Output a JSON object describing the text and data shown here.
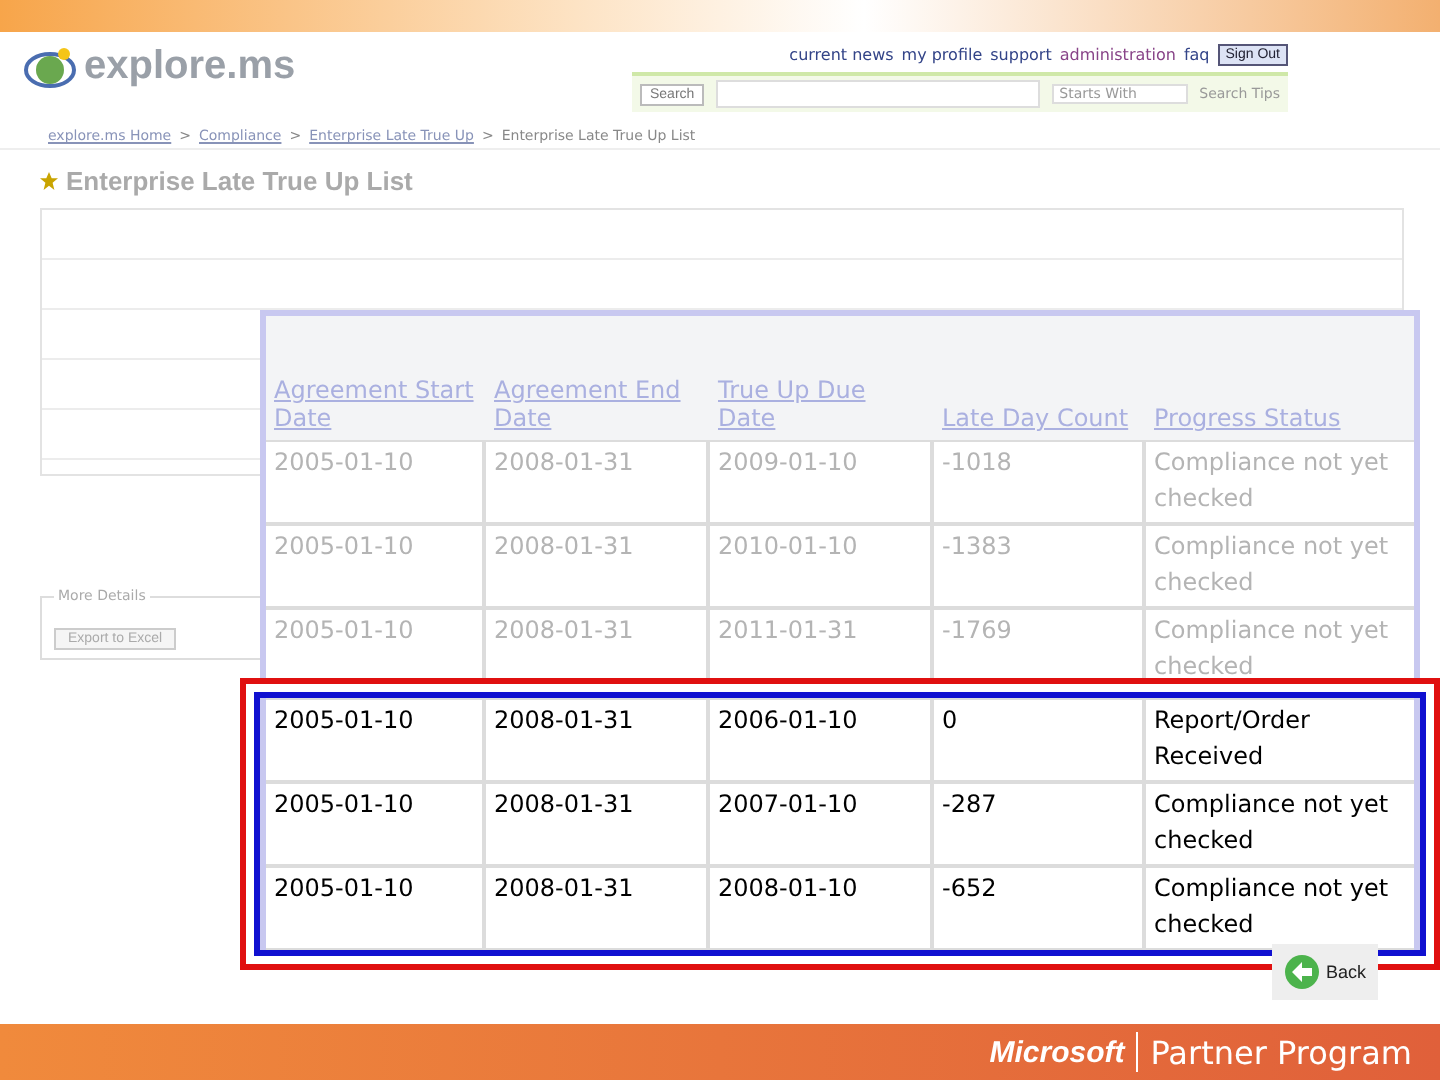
{
  "header": {
    "logo": "explore.ms",
    "nav": [
      "current news",
      "my profile",
      "support",
      "administration",
      "faq"
    ],
    "sign_out": "Sign Out",
    "search_button": "Search",
    "match_mode": "Starts With",
    "search_tips": "Search Tips"
  },
  "breadcrumb_separator": ">",
  "breadcrumbs": [
    "explore.ms Home",
    "Compliance",
    "Enterprise Late True Up",
    "Enterprise Late True Up List"
  ],
  "title": "Enterprise Late True Up List",
  "more_details": {
    "legend": "More Details",
    "button": "Export to Excel"
  },
  "zoom_table": {
    "columns": [
      "Agreement Start Date",
      "Agreement End Date",
      "True Up Due Date",
      "Late Day Count",
      "Progress Status"
    ],
    "rows": [
      {
        "cells": [
          "2005-01-10",
          "2008-01-31",
          "2009-01-10",
          "-1018",
          "Compliance not yet checked"
        ],
        "highlighted": false
      },
      {
        "cells": [
          "2005-01-10",
          "2008-01-31",
          "2010-01-10",
          "-1383",
          "Compliance not yet checked"
        ],
        "highlighted": false
      },
      {
        "cells": [
          "2005-01-10",
          "2008-01-31",
          "2011-01-31",
          "-1769",
          "Compliance not yet checked"
        ],
        "highlighted": false
      },
      {
        "cells": [
          "2005-01-10",
          "2008-01-31",
          "2006-01-10",
          "0",
          "Report/Order Received"
        ],
        "highlighted": true
      },
      {
        "cells": [
          "2005-01-10",
          "2008-01-31",
          "2007-01-10",
          "-287",
          "Compliance not yet checked"
        ],
        "highlighted": true
      },
      {
        "cells": [
          "2005-01-10",
          "2008-01-31",
          "2008-01-10",
          "-652",
          "Compliance not yet checked"
        ],
        "highlighted": true
      }
    ]
  },
  "back_button": "Back",
  "footer": {
    "brand": "Microsoft",
    "program": "Partner Program"
  }
}
